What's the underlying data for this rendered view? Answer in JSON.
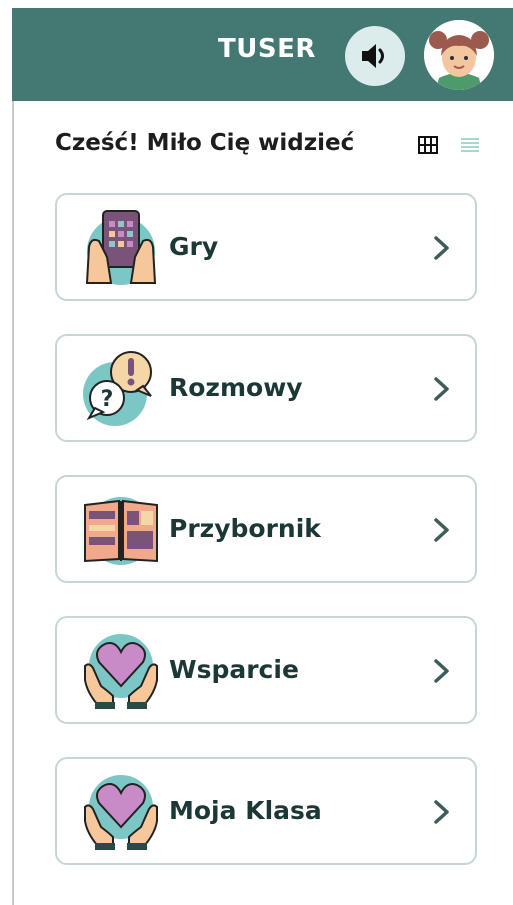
{
  "header": {
    "title": "TUSER",
    "sound_icon": "speaker-icon",
    "avatar_icon": "child-avatar"
  },
  "greeting": "Cześć! Miło Cię widzieć",
  "view_toggles": [
    "grid-view-icon",
    "list-view-icon"
  ],
  "menu": [
    {
      "label": "Gry",
      "icon": "tablet-hands-icon"
    },
    {
      "label": "Rozmowy",
      "icon": "speech-bubbles-icon"
    },
    {
      "label": "Przybornik",
      "icon": "open-book-icon"
    },
    {
      "label": "Wsparcie",
      "icon": "heart-hands-icon"
    },
    {
      "label": "Moja Klasa",
      "icon": "heart-hands-icon"
    }
  ],
  "colors": {
    "header_bg": "#447872",
    "card_border": "#c5d6d6",
    "icon_circle": "#7cc6c6",
    "purple": "#7a5478",
    "pink_heart": "#c98bc7",
    "skin": "#f5c79a"
  }
}
